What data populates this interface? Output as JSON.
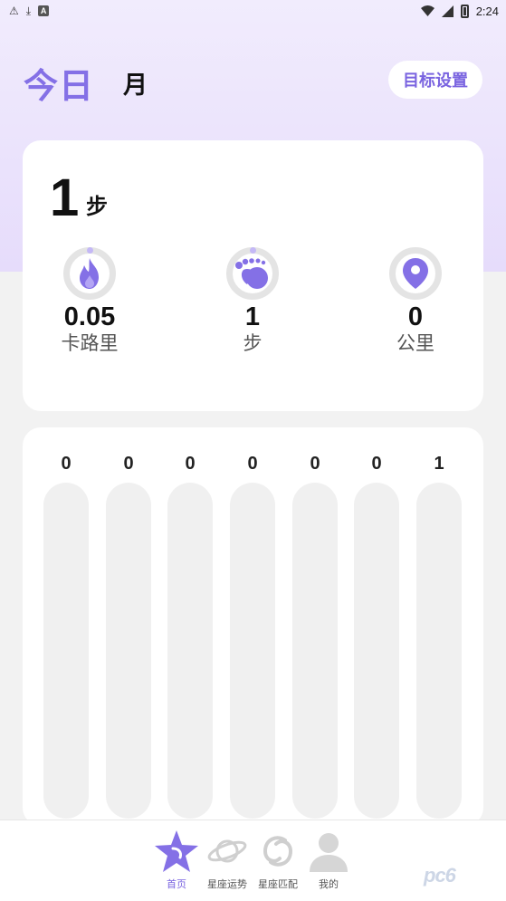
{
  "status_bar": {
    "time": "2:24",
    "icons": [
      "warning-icon",
      "download-icon",
      "app-icon",
      "wifi-icon",
      "signal-icon",
      "battery-icon"
    ]
  },
  "header": {
    "tabs": [
      {
        "label": "今日",
        "active": true
      },
      {
        "label": "月",
        "active": false
      }
    ],
    "goal_button": "目标设置"
  },
  "summary": {
    "steps_value": "1",
    "steps_unit": "步",
    "metrics": [
      {
        "icon": "flame-icon",
        "value": "0.05",
        "label": "卡路里"
      },
      {
        "icon": "footprint-icon",
        "value": "1",
        "label": "步"
      },
      {
        "icon": "location-pin-icon",
        "value": "0",
        "label": "公里"
      }
    ]
  },
  "chart_data": {
    "type": "bar",
    "values": [
      0,
      0,
      0,
      0,
      0,
      0,
      1
    ],
    "value_labels": [
      "0",
      "0",
      "0",
      "0",
      "0",
      "0",
      "1"
    ]
  },
  "bottom_nav": {
    "items": [
      {
        "label": "首页",
        "icon": "star-icon",
        "active": true
      },
      {
        "label": "星座运势",
        "icon": "planet-icon",
        "active": false
      },
      {
        "label": "星座匹配",
        "icon": "swirl-icon",
        "active": false
      },
      {
        "label": "我的",
        "icon": "user-icon",
        "active": false
      }
    ]
  },
  "colors": {
    "accent": "#8470e6",
    "accent_light": "#c4b8f6",
    "header_bg": "#ede6fd",
    "card_bg": "#ffffff",
    "page_bg": "#f2f2f2"
  },
  "watermark": "pc6"
}
